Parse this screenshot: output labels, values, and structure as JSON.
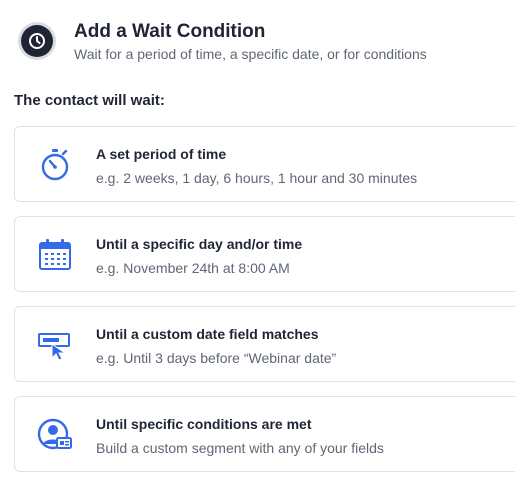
{
  "header": {
    "icon": "clock-icon",
    "title": "Add a Wait Condition",
    "subtitle": "Wait for a period of time, a specific date, or for conditions"
  },
  "section_label": "The contact will wait:",
  "accent_color": "#356ae6",
  "options": [
    {
      "icon": "stopwatch-icon",
      "title": "A set period of time",
      "description": "e.g. 2 weeks, 1 day, 6 hours, 1 hour and 30 minutes"
    },
    {
      "icon": "calendar-icon",
      "title": "Until a specific day and/or time",
      "description": "e.g. November 24th at 8:00 AM"
    },
    {
      "icon": "date-field-cursor-icon",
      "title": "Until a custom date field matches",
      "description": "e.g. Until 3 days before “Webinar date”"
    },
    {
      "icon": "contact-card-icon",
      "title": "Until specific conditions are met",
      "description": "Build a custom segment with any of your fields"
    }
  ]
}
